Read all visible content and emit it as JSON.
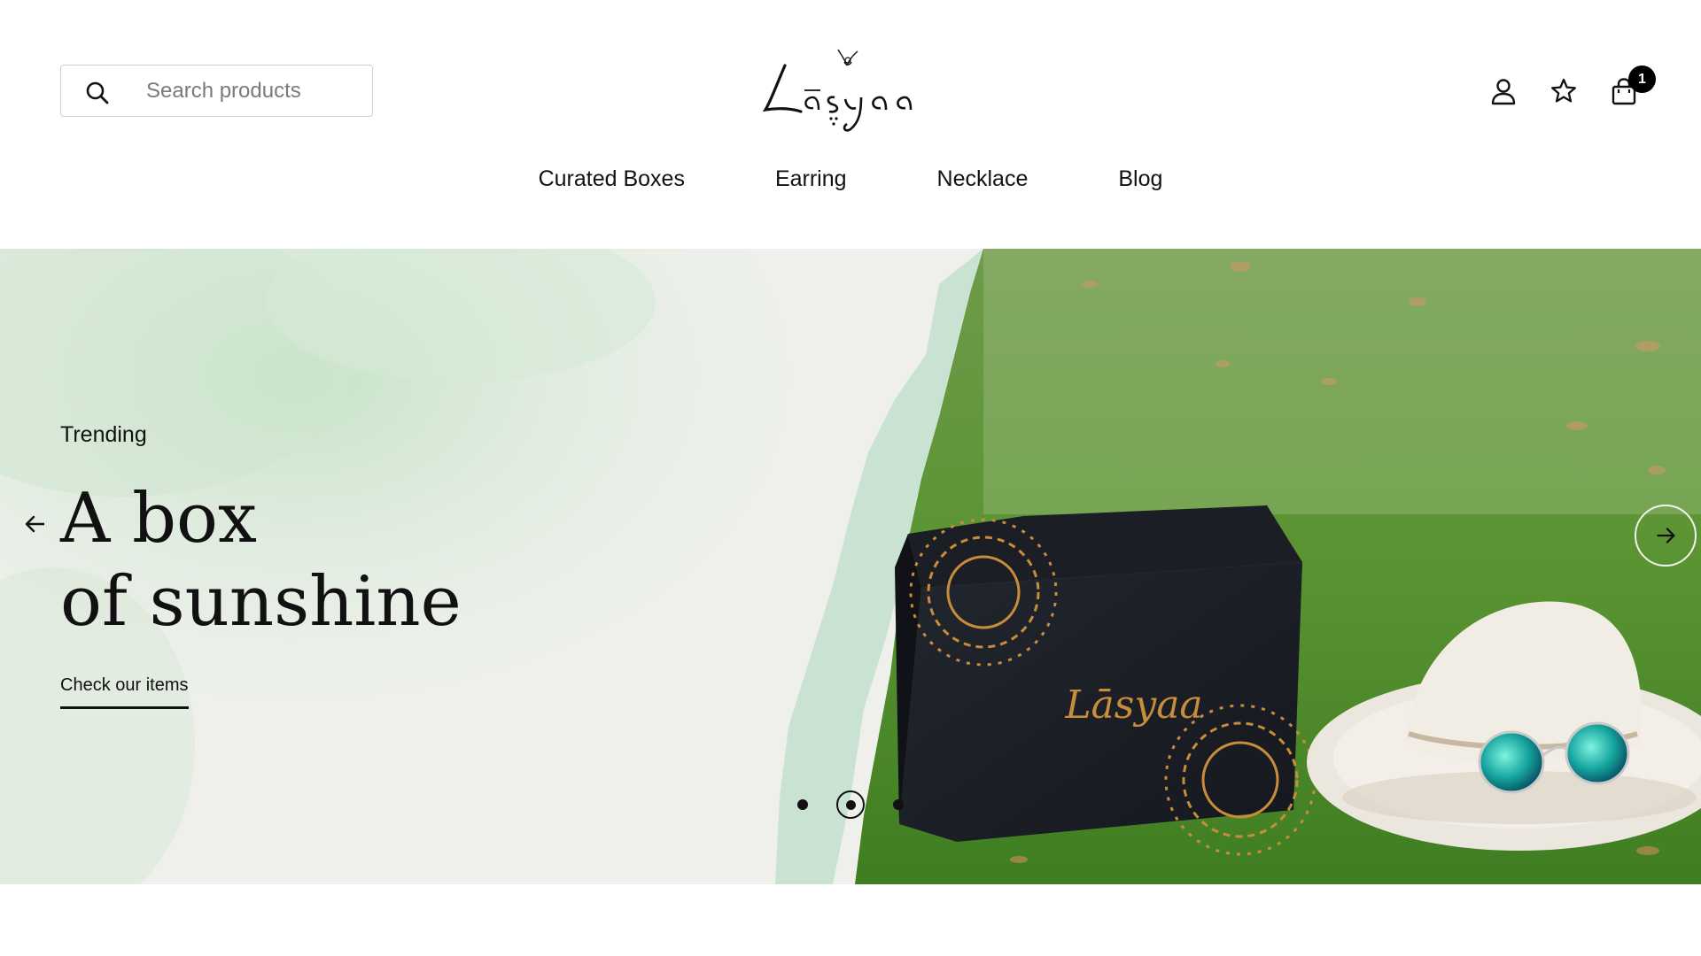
{
  "search": {
    "placeholder": "Search products"
  },
  "brand": {
    "name": "Lāsyaa"
  },
  "header_icons": [
    "search-icon",
    "user-icon",
    "star-icon",
    "shopping-bag-icon"
  ],
  "cart": {
    "count": "1"
  },
  "nav": {
    "items": [
      {
        "label": "Curated Boxes"
      },
      {
        "label": "Earring"
      },
      {
        "label": "Necklace"
      },
      {
        "label": "Blog"
      }
    ]
  },
  "hero": {
    "subtitle": "Trending",
    "title_line1": "A box",
    "title_line2": "of sunshine",
    "cta": "Check our items",
    "box_brand": "Lāsyaa",
    "slides": 3,
    "active_slide": 2
  },
  "colors": {
    "accent": "#000000",
    "grass": "#5f9a35",
    "watercolor": "#cfe6d4",
    "box": "#1c2027",
    "gold": "#c48a3a"
  }
}
